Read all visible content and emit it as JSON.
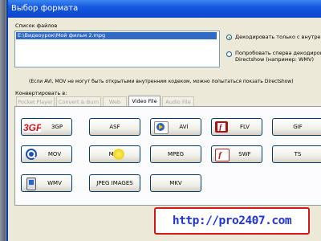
{
  "window": {
    "title": "Выбор формата"
  },
  "files": {
    "label": "Список файлов",
    "items": [
      "E:\\Видеоурок\\Мой фильм 2.mpg"
    ]
  },
  "decode": {
    "options": [
      {
        "label": "Декодировать только с внутренн",
        "selected": true
      },
      {
        "label_lines": [
          "Попробовать сперва декодирова",
          "Directshow (например: WMV)"
        ],
        "selected": false
      }
    ],
    "note": "(Если AVI, MOV не могут быть открытыми внутренним кодеком, можно попытаться покзать Directshow)"
  },
  "convert": {
    "label": "Конвертировать в:",
    "tabs": [
      "Pocket Player",
      "Convert & Burn",
      "Web",
      "Video File",
      "Audio File"
    ],
    "active_tab": "Video File",
    "formats": [
      {
        "label": "3GP",
        "icon": "3gp-logo-icon"
      },
      {
        "label": "ASF",
        "icon": ""
      },
      {
        "label": "AVI",
        "icon": "media-player-icon"
      },
      {
        "label": "FLV",
        "icon": "flash-video-icon"
      },
      {
        "label": "GIF",
        "icon": ""
      },
      {
        "label": "MOV",
        "icon": "quicktime-icon"
      },
      {
        "label": "MP4",
        "icon": ""
      },
      {
        "label": "MPEG",
        "icon": ""
      },
      {
        "label": "SWF",
        "icon": "flash-icon"
      },
      {
        "label": "TS",
        "icon": ""
      },
      {
        "label": "WMV",
        "icon": "pda-icon"
      },
      {
        "label": "JPEG IMAGES",
        "icon": ""
      },
      {
        "label": "MKV",
        "icon": ""
      }
    ]
  },
  "overlay": {
    "url": "http://pro2407.com"
  },
  "colors": {
    "accent_title": "#1558e0",
    "url_text": "#1f34d8",
    "url_border": "#d01818"
  }
}
